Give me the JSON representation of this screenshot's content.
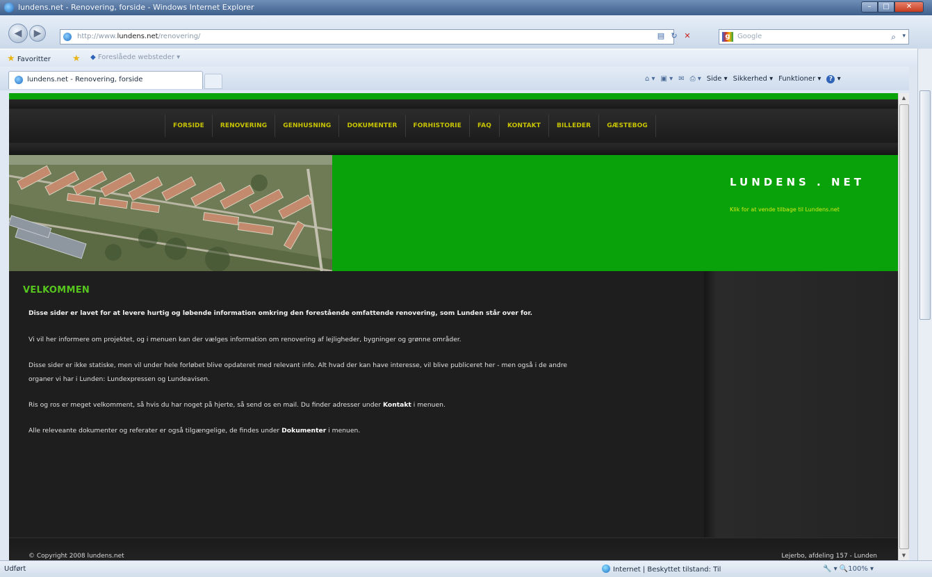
{
  "window": {
    "title": "lundens.net - Renovering, forside - Windows Internet Explorer",
    "min": "–",
    "max": "□",
    "close": "✕"
  },
  "address": {
    "url_prefix": "http://www.",
    "url_domain": "lundens.net",
    "url_path": "/renovering/",
    "search_placeholder": "Google"
  },
  "favorites": {
    "label": "Favoritter",
    "suggested": "Foreslåede websteder ▾"
  },
  "tab": {
    "label": "lundens.net - Renovering, forside"
  },
  "commandbar": {
    "page": "Side ▾",
    "safety": "Sikkerhed ▾",
    "tools": "Funktioner ▾"
  },
  "site": {
    "nav": [
      "FORSIDE",
      "RENOVERING",
      "GENHUSNING",
      "DOKUMENTER",
      "FORHISTORIE",
      "FAQ",
      "KONTAKT",
      "BILLEDER",
      "GÆSTEBOG"
    ],
    "brand": "LUNDENS . NET",
    "brand_link": "Klik for at vende tilbage til Lundens.net",
    "heading": "VELKOMMEN",
    "p1": "Disse sider er lavet for at levere hurtig og løbende information omkring den forestående omfattende renovering, som Lunden står over for.",
    "p2": "Vi vil her informere om projektet, og i menuen kan der vælges information om renovering af lejligheder, bygninger og grønne områder.",
    "p3a": "Disse sider er ikke statiske, men vil under hele forløbet blive opdateret med relevant info. Alt hvad der kan have interesse, vil blive publiceret her - men også i de andre",
    "p3b": "organer vi har i Lunden: Lundexpressen og Lundeavisen.",
    "p4_pre": "Ris og ros er meget velkomment, så hvis du har noget på hjerte, så send os en mail. Du finder adresser under ",
    "p4_bold": "Kontakt",
    "p4_post": " i menuen.",
    "p5_pre": "Alle releveante dokumenter og referater er også tilgængelige, de findes under ",
    "p5_bold": "Dokumenter",
    "p5_post": " i menuen.",
    "footer_left": "© Copyright 2008 lundens.net",
    "footer_right": "Lejerbo, afdeling 157 - Lunden"
  },
  "status": {
    "left": "Udført",
    "zone": "Internet | Beskyttet tilstand: Til",
    "zoom": "🔧 ▾   🔍100%  ▾"
  },
  "colors": {
    "accent_green": "#0aa20a",
    "menu_yellow": "#c8c400",
    "heading_green": "#57c51e"
  }
}
